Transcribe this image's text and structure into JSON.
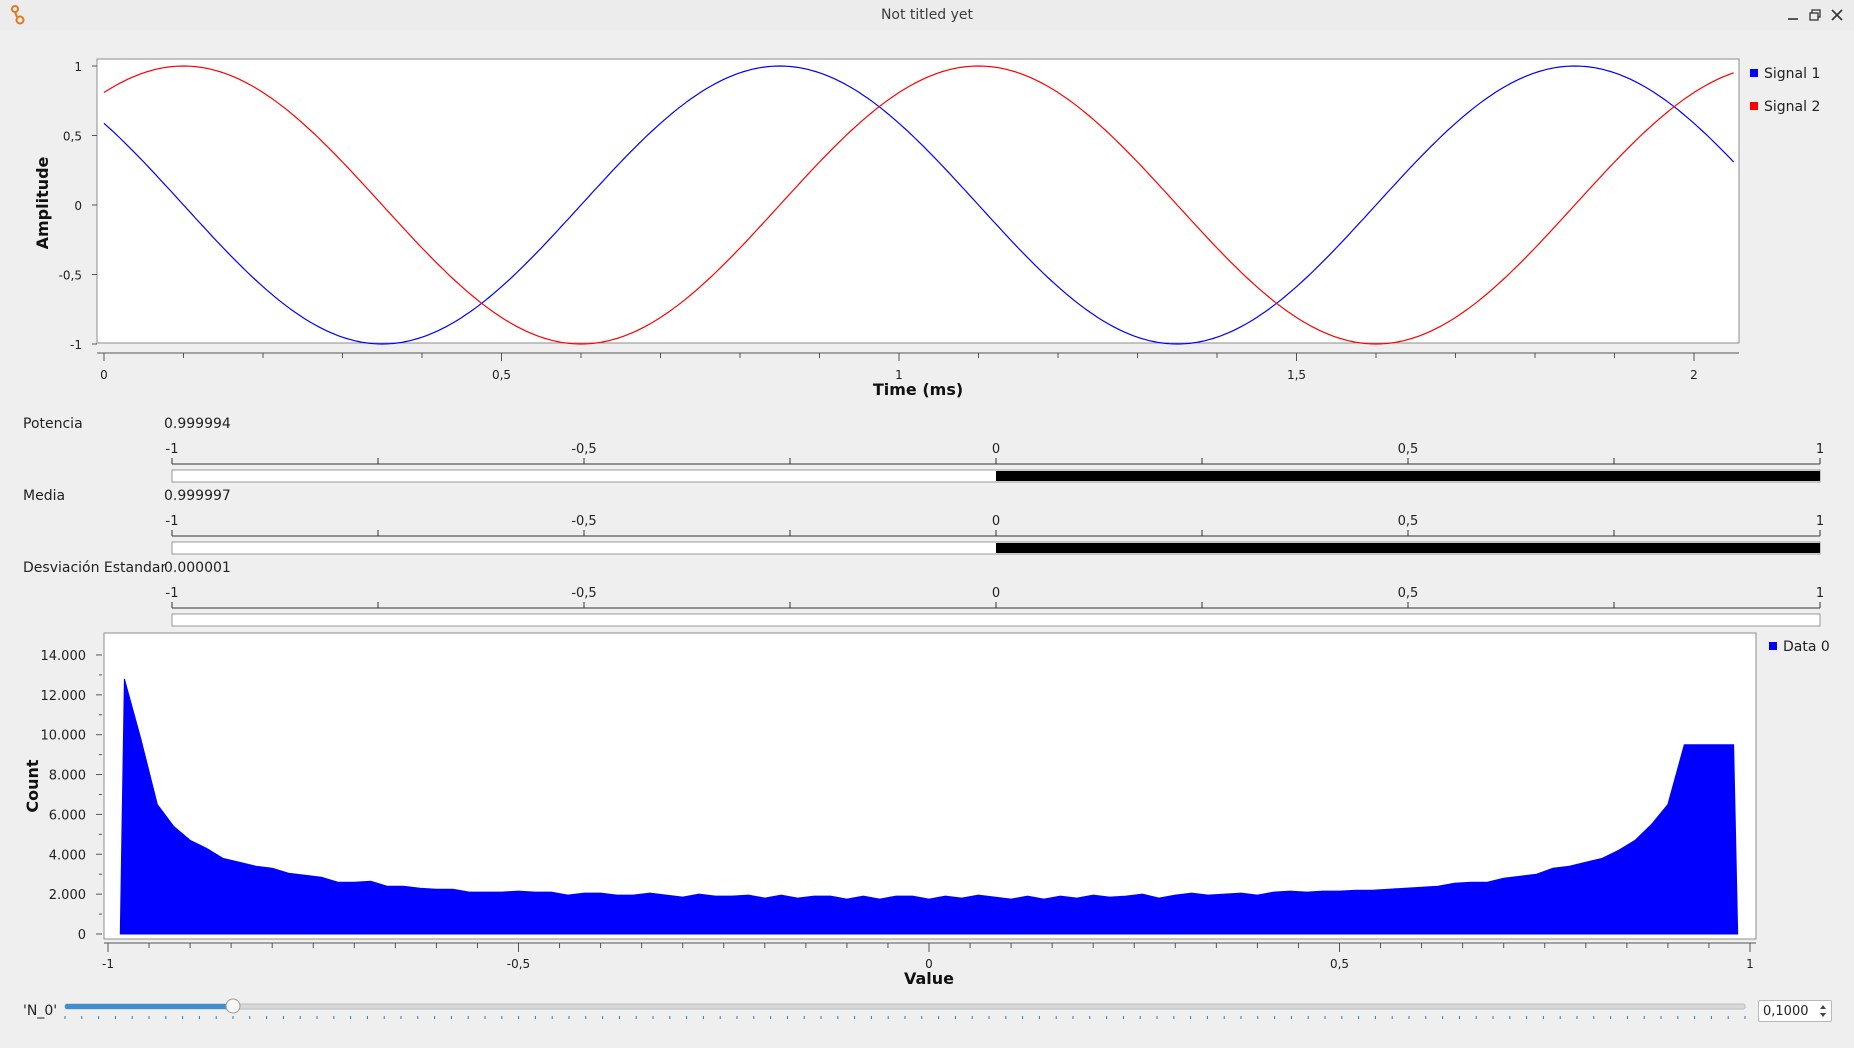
{
  "window": {
    "title": "Not titled yet",
    "app_icon": "gnuradio-icon",
    "controls": [
      "minimize-icon",
      "maximize-icon",
      "close-icon"
    ]
  },
  "time_plot": {
    "ylabel": "Amplitude",
    "xlabel": "Time (ms)",
    "y_ticks": [
      "1",
      "0,5",
      "0",
      "-0,5",
      "-1"
    ],
    "x_ticks": [
      "0",
      "0,5",
      "1",
      "1,5",
      "2"
    ],
    "legend": [
      "Signal 1",
      "Signal 2"
    ],
    "colors": [
      "#0000ff",
      "#ff0000"
    ]
  },
  "gauges": [
    {
      "label": "Potencia",
      "value": "0.999994",
      "ticks": [
        "-1",
        "-0,5",
        "0",
        "0,5",
        "1"
      ],
      "level": 0.999994
    },
    {
      "label": "Media",
      "value": "0.999997",
      "ticks": [
        "-1",
        "-0,5",
        "0",
        "0,5",
        "1"
      ],
      "level": 0.999997
    },
    {
      "label": "Desviación Estandar",
      "value": "0.000001",
      "ticks": [
        "-1",
        "-0,5",
        "0",
        "0,5",
        "1"
      ],
      "level": 1e-06
    }
  ],
  "histogram": {
    "ylabel": "Count",
    "xlabel": "Value",
    "y_ticks": [
      "14.000",
      "12.000",
      "10.000",
      "8.000",
      "6.000",
      "4.000",
      "2.000",
      "0"
    ],
    "x_ticks": [
      "-1",
      "-0,5",
      "0",
      "0,5",
      "1"
    ],
    "legend": [
      "Data 0"
    ],
    "color": "#0000ff"
  },
  "slider": {
    "label": "'N_0'",
    "value_text": "0,1000",
    "level": 0.1
  },
  "chart_data": [
    {
      "type": "line",
      "xlabel": "Time (ms)",
      "ylabel": "Amplitude",
      "xlim": [
        0,
        2.05
      ],
      "ylim": [
        -1,
        1
      ],
      "series": [
        {
          "name": "Signal 1",
          "x": [
            0,
            0.1,
            0.2,
            0.3,
            0.35,
            0.4,
            0.5,
            0.6,
            0.7,
            0.8,
            0.85,
            0.9,
            1.0,
            1.1,
            1.2,
            1.3,
            1.35,
            1.4,
            1.5,
            1.6,
            1.7,
            1.8,
            1.85,
            1.9,
            2.0,
            2.05
          ],
          "y": [
            0.59,
            0.0,
            -0.59,
            -0.95,
            -1.0,
            -0.95,
            -0.59,
            0.0,
            0.59,
            0.95,
            1.0,
            0.95,
            0.59,
            0.0,
            -0.59,
            -0.95,
            -1.0,
            -0.95,
            -0.59,
            0.0,
            0.59,
            0.95,
            1.0,
            0.95,
            0.59,
            0.31
          ]
        },
        {
          "name": "Signal 2",
          "x": [
            0,
            0.1,
            0.2,
            0.3,
            0.35,
            0.4,
            0.5,
            0.6,
            0.7,
            0.8,
            0.85,
            0.9,
            1.0,
            1.1,
            1.2,
            1.3,
            1.35,
            1.4,
            1.5,
            1.6,
            1.7,
            1.8,
            1.85,
            1.9,
            2.0,
            2.05
          ],
          "y": [
            0.81,
            1.0,
            0.81,
            0.31,
            0.0,
            -0.31,
            -0.81,
            -1.0,
            -0.81,
            -0.31,
            0.0,
            0.31,
            0.81,
            1.0,
            0.81,
            0.31,
            0.0,
            -0.31,
            -0.81,
            -1.0,
            -0.81,
            -0.31,
            0.0,
            0.31,
            0.81,
            0.95
          ]
        }
      ]
    },
    {
      "type": "area",
      "xlabel": "Value",
      "ylabel": "Count",
      "xlim": [
        -1,
        1
      ],
      "ylim": [
        0,
        14500
      ],
      "series": [
        {
          "name": "Data 0",
          "x": [
            -0.98,
            -0.96,
            -0.94,
            -0.92,
            -0.9,
            -0.88,
            -0.86,
            -0.84,
            -0.82,
            -0.8,
            -0.78,
            -0.76,
            -0.74,
            -0.72,
            -0.7,
            -0.68,
            -0.66,
            -0.64,
            -0.62,
            -0.6,
            -0.58,
            -0.56,
            -0.54,
            -0.52,
            -0.5,
            -0.48,
            -0.46,
            -0.44,
            -0.42,
            -0.4,
            -0.38,
            -0.36,
            -0.34,
            -0.32,
            -0.3,
            -0.28,
            -0.26,
            -0.24,
            -0.22,
            -0.2,
            -0.18,
            -0.16,
            -0.14,
            -0.12,
            -0.1,
            -0.08,
            -0.06,
            -0.04,
            -0.02,
            0.0,
            0.02,
            0.04,
            0.06,
            0.08,
            0.1,
            0.12,
            0.14,
            0.16,
            0.18,
            0.2,
            0.22,
            0.24,
            0.26,
            0.28,
            0.3,
            0.32,
            0.34,
            0.36,
            0.38,
            0.4,
            0.42,
            0.44,
            0.46,
            0.48,
            0.5,
            0.52,
            0.54,
            0.56,
            0.58,
            0.6,
            0.62,
            0.64,
            0.66,
            0.68,
            0.7,
            0.72,
            0.74,
            0.76,
            0.78,
            0.8,
            0.82,
            0.84,
            0.86,
            0.88,
            0.9,
            0.92,
            0.94,
            0.96,
            0.98
          ],
          "y": [
            12800,
            9800,
            6500,
            5400,
            4700,
            4300,
            3800,
            3600,
            3400,
            3300,
            3050,
            2950,
            2850,
            2600,
            2600,
            2650,
            2400,
            2400,
            2300,
            2250,
            2250,
            2100,
            2100,
            2100,
            2150,
            2100,
            2100,
            1950,
            2050,
            2050,
            1950,
            1950,
            2050,
            1950,
            1850,
            2000,
            1900,
            1900,
            1950,
            1800,
            1950,
            1800,
            1900,
            1900,
            1750,
            1900,
            1750,
            1900,
            1900,
            1750,
            1900,
            1800,
            1950,
            1850,
            1750,
            1900,
            1750,
            1900,
            1800,
            1950,
            1850,
            1900,
            2000,
            1800,
            1950,
            2050,
            1950,
            2000,
            2050,
            1950,
            2100,
            2150,
            2100,
            2150,
            2150,
            2200,
            2200,
            2250,
            2300,
            2350,
            2400,
            2550,
            2600,
            2600,
            2800,
            2900,
            3000,
            3300,
            3400,
            3600,
            3800,
            4200,
            4700,
            5500,
            6500,
            9500,
            9500,
            9500,
            9500
          ]
        }
      ]
    }
  ]
}
